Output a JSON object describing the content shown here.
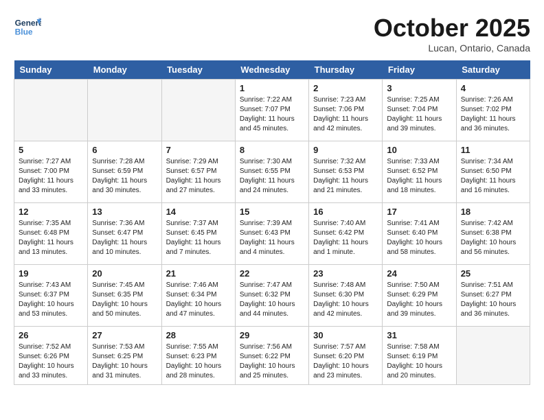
{
  "header": {
    "logo_line1": "General",
    "logo_line2": "Blue",
    "month": "October 2025",
    "location": "Lucan, Ontario, Canada"
  },
  "days_of_week": [
    "Sunday",
    "Monday",
    "Tuesday",
    "Wednesday",
    "Thursday",
    "Friday",
    "Saturday"
  ],
  "weeks": [
    [
      {
        "num": "",
        "info": ""
      },
      {
        "num": "",
        "info": ""
      },
      {
        "num": "",
        "info": ""
      },
      {
        "num": "1",
        "info": "Sunrise: 7:22 AM\nSunset: 7:07 PM\nDaylight: 11 hours\nand 45 minutes."
      },
      {
        "num": "2",
        "info": "Sunrise: 7:23 AM\nSunset: 7:06 PM\nDaylight: 11 hours\nand 42 minutes."
      },
      {
        "num": "3",
        "info": "Sunrise: 7:25 AM\nSunset: 7:04 PM\nDaylight: 11 hours\nand 39 minutes."
      },
      {
        "num": "4",
        "info": "Sunrise: 7:26 AM\nSunset: 7:02 PM\nDaylight: 11 hours\nand 36 minutes."
      }
    ],
    [
      {
        "num": "5",
        "info": "Sunrise: 7:27 AM\nSunset: 7:00 PM\nDaylight: 11 hours\nand 33 minutes."
      },
      {
        "num": "6",
        "info": "Sunrise: 7:28 AM\nSunset: 6:59 PM\nDaylight: 11 hours\nand 30 minutes."
      },
      {
        "num": "7",
        "info": "Sunrise: 7:29 AM\nSunset: 6:57 PM\nDaylight: 11 hours\nand 27 minutes."
      },
      {
        "num": "8",
        "info": "Sunrise: 7:30 AM\nSunset: 6:55 PM\nDaylight: 11 hours\nand 24 minutes."
      },
      {
        "num": "9",
        "info": "Sunrise: 7:32 AM\nSunset: 6:53 PM\nDaylight: 11 hours\nand 21 minutes."
      },
      {
        "num": "10",
        "info": "Sunrise: 7:33 AM\nSunset: 6:52 PM\nDaylight: 11 hours\nand 18 minutes."
      },
      {
        "num": "11",
        "info": "Sunrise: 7:34 AM\nSunset: 6:50 PM\nDaylight: 11 hours\nand 16 minutes."
      }
    ],
    [
      {
        "num": "12",
        "info": "Sunrise: 7:35 AM\nSunset: 6:48 PM\nDaylight: 11 hours\nand 13 minutes."
      },
      {
        "num": "13",
        "info": "Sunrise: 7:36 AM\nSunset: 6:47 PM\nDaylight: 11 hours\nand 10 minutes."
      },
      {
        "num": "14",
        "info": "Sunrise: 7:37 AM\nSunset: 6:45 PM\nDaylight: 11 hours\nand 7 minutes."
      },
      {
        "num": "15",
        "info": "Sunrise: 7:39 AM\nSunset: 6:43 PM\nDaylight: 11 hours\nand 4 minutes."
      },
      {
        "num": "16",
        "info": "Sunrise: 7:40 AM\nSunset: 6:42 PM\nDaylight: 11 hours\nand 1 minute."
      },
      {
        "num": "17",
        "info": "Sunrise: 7:41 AM\nSunset: 6:40 PM\nDaylight: 10 hours\nand 58 minutes."
      },
      {
        "num": "18",
        "info": "Sunrise: 7:42 AM\nSunset: 6:38 PM\nDaylight: 10 hours\nand 56 minutes."
      }
    ],
    [
      {
        "num": "19",
        "info": "Sunrise: 7:43 AM\nSunset: 6:37 PM\nDaylight: 10 hours\nand 53 minutes."
      },
      {
        "num": "20",
        "info": "Sunrise: 7:45 AM\nSunset: 6:35 PM\nDaylight: 10 hours\nand 50 minutes."
      },
      {
        "num": "21",
        "info": "Sunrise: 7:46 AM\nSunset: 6:34 PM\nDaylight: 10 hours\nand 47 minutes."
      },
      {
        "num": "22",
        "info": "Sunrise: 7:47 AM\nSunset: 6:32 PM\nDaylight: 10 hours\nand 44 minutes."
      },
      {
        "num": "23",
        "info": "Sunrise: 7:48 AM\nSunset: 6:30 PM\nDaylight: 10 hours\nand 42 minutes."
      },
      {
        "num": "24",
        "info": "Sunrise: 7:50 AM\nSunset: 6:29 PM\nDaylight: 10 hours\nand 39 minutes."
      },
      {
        "num": "25",
        "info": "Sunrise: 7:51 AM\nSunset: 6:27 PM\nDaylight: 10 hours\nand 36 minutes."
      }
    ],
    [
      {
        "num": "26",
        "info": "Sunrise: 7:52 AM\nSunset: 6:26 PM\nDaylight: 10 hours\nand 33 minutes."
      },
      {
        "num": "27",
        "info": "Sunrise: 7:53 AM\nSunset: 6:25 PM\nDaylight: 10 hours\nand 31 minutes."
      },
      {
        "num": "28",
        "info": "Sunrise: 7:55 AM\nSunset: 6:23 PM\nDaylight: 10 hours\nand 28 minutes."
      },
      {
        "num": "29",
        "info": "Sunrise: 7:56 AM\nSunset: 6:22 PM\nDaylight: 10 hours\nand 25 minutes."
      },
      {
        "num": "30",
        "info": "Sunrise: 7:57 AM\nSunset: 6:20 PM\nDaylight: 10 hours\nand 23 minutes."
      },
      {
        "num": "31",
        "info": "Sunrise: 7:58 AM\nSunset: 6:19 PM\nDaylight: 10 hours\nand 20 minutes."
      },
      {
        "num": "",
        "info": ""
      }
    ]
  ]
}
